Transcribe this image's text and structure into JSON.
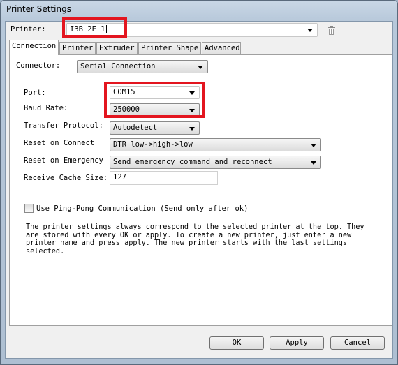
{
  "window": {
    "title": "Printer Settings"
  },
  "printer": {
    "label": "Printer:",
    "value": "I3B_2E_1",
    "delete_icon": "trash-icon"
  },
  "tabs": [
    {
      "label": "Connection",
      "active": true
    },
    {
      "label": "Printer"
    },
    {
      "label": "Extruder"
    },
    {
      "label": "Printer Shape"
    },
    {
      "label": "Advanced"
    }
  ],
  "connection": {
    "connector_label": "Connector:",
    "connector_value": "Serial Connection",
    "port_label": "Port:",
    "port_value": "COM15",
    "baud_label": "Baud Rate:",
    "baud_value": "250000",
    "protocol_label": "Transfer Protocol:",
    "protocol_value": "Autodetect",
    "reset_connect_label": "Reset on Connect",
    "reset_connect_value": "DTR low->high->low",
    "reset_emergency_label": "Reset on Emergency",
    "reset_emergency_value": "Send emergency command and reconnect",
    "cache_label": "Receive Cache Size:",
    "cache_value": "127",
    "pingpong_label": "Use Ping-Pong Communication (Send only after ok)",
    "pingpong_checked": false,
    "help_text": "The printer settings always correspond to the selected printer at the top. They\nare stored with every OK or apply. To create a new printer, just enter a new\nprinter name and press apply. The new printer starts with the last settings\nselected."
  },
  "buttons": {
    "ok": "OK",
    "apply": "Apply",
    "cancel": "Cancel"
  },
  "colors": {
    "highlight": "#e3151f"
  }
}
